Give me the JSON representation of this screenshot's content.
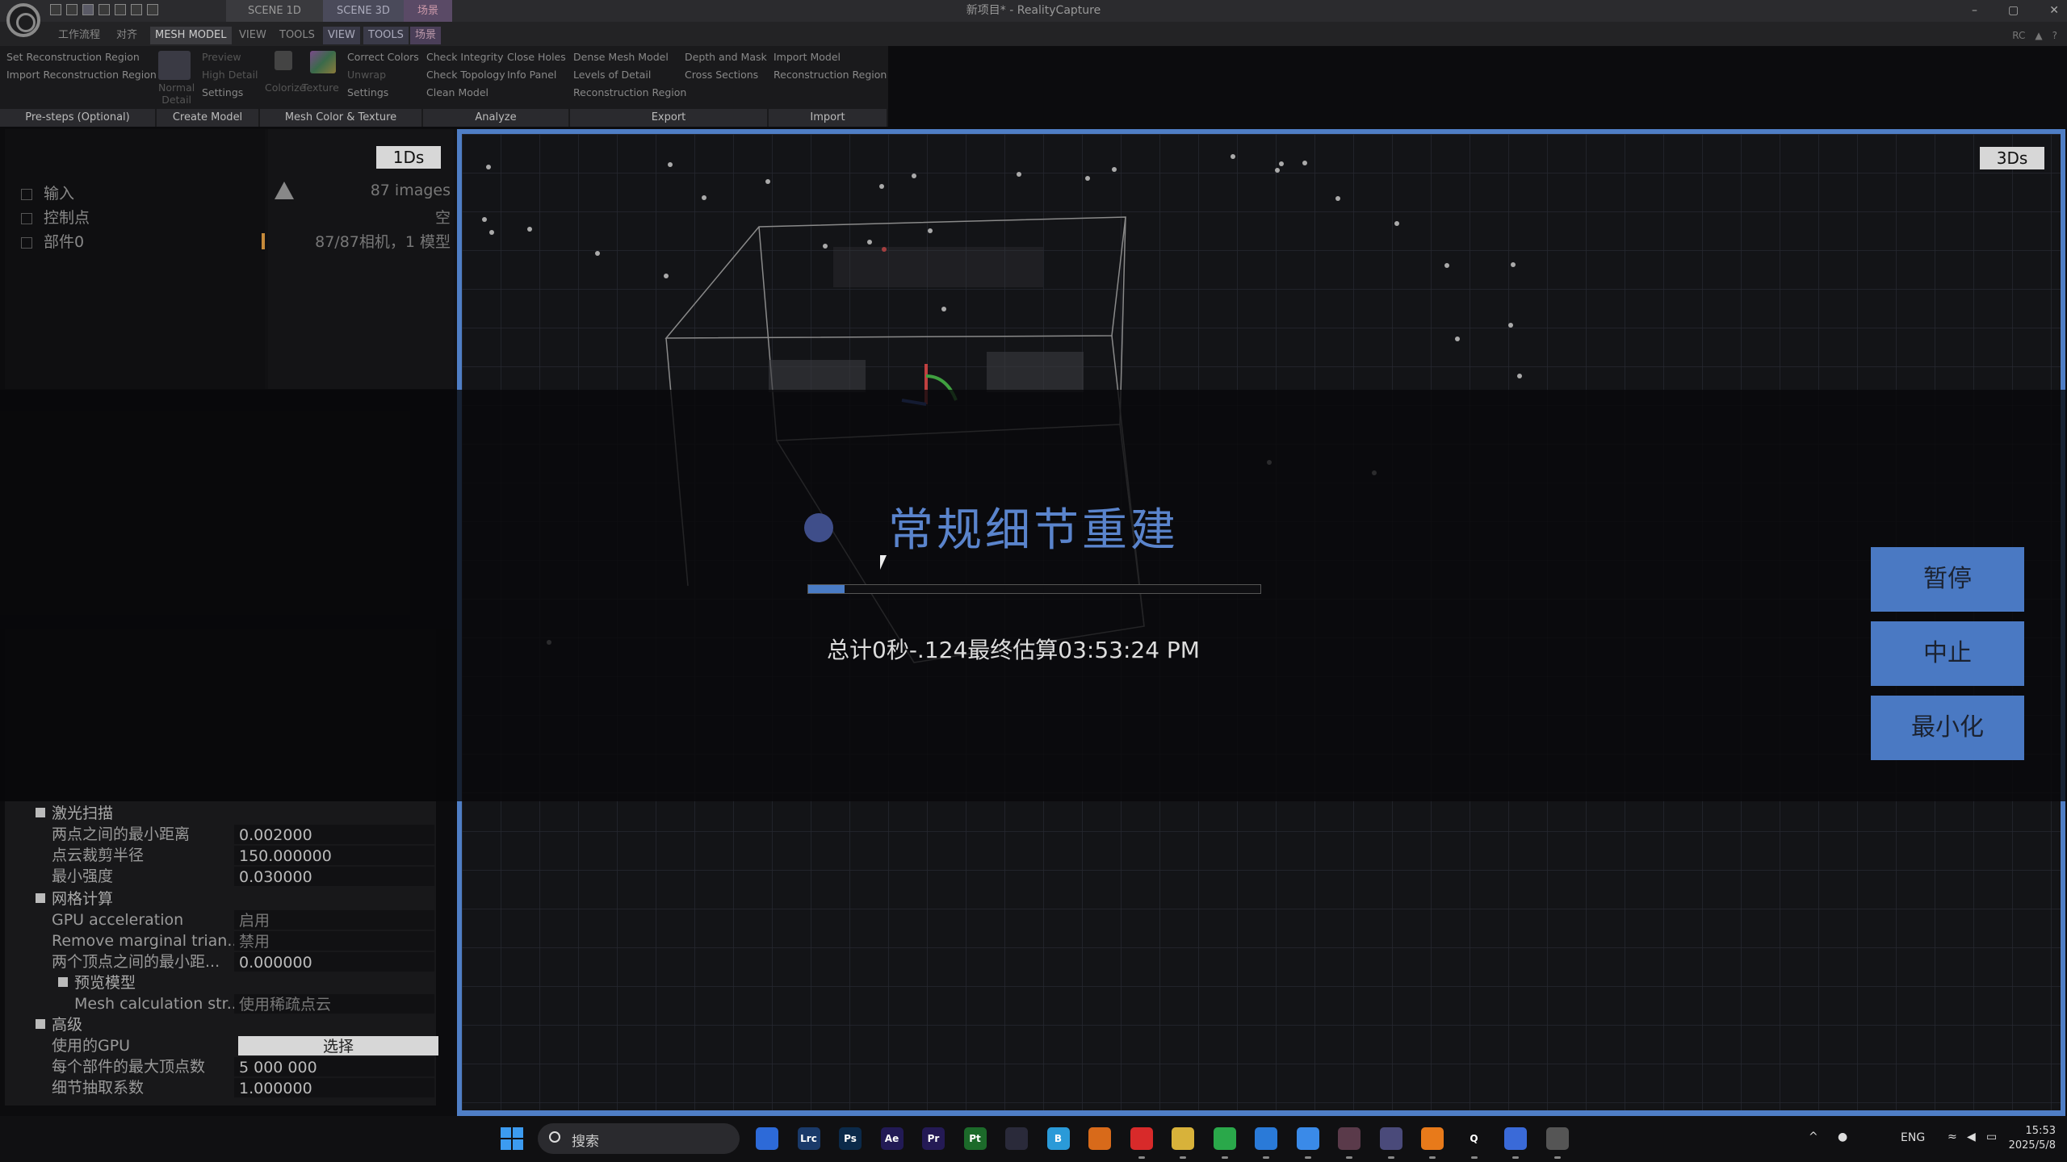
{
  "window": {
    "title": "新项目* - RealityCapture",
    "controls": [
      "–",
      "▢",
      "✕"
    ]
  },
  "scene_tabs": {
    "scene1d": "SCENE 1D",
    "scene3d": "SCENE 3D",
    "scene_cn": "场景"
  },
  "ribbon_tabs": {
    "workflow": "工作流程",
    "align": "对齐",
    "mesh_model": "MESH MODEL",
    "view1": "VIEW",
    "tools1": "TOOLS",
    "view2": "VIEW",
    "tools2": "TOOLS",
    "scene": "场景",
    "rc": "RC"
  },
  "ribbon": {
    "set_region": "Set Reconstruction Region",
    "import_region": "Import Reconstruction Region",
    "normal_detail": "Normal\nDetail",
    "preview": "Preview",
    "high_detail": "High Detail",
    "settings1": "Settings",
    "colorize": "Colorize",
    "texture": "Texture",
    "correct_colors": "Correct Colors",
    "unwrap": "Unwrap",
    "settings2": "Settings",
    "check_integrity": "Check Integrity",
    "check_topology": "Check Topology",
    "clean_model": "Clean Model",
    "close_holes": "Close Holes",
    "info_panel": "Info Panel",
    "dense_mesh": "Dense Mesh Model",
    "levels_detail": "Levels of Detail",
    "recon_region_export": "Reconstruction Region",
    "depth_mask": "Depth and Mask",
    "cross_sections": "Cross Sections",
    "import_model": "Import Model",
    "recon_region_import": "Reconstruction Region",
    "groups": {
      "presteps": "Pre-steps (Optional)",
      "create_model": "Create Model",
      "mesh_color": "Mesh Color & Texture",
      "analyze": "Analyze",
      "export": "Export",
      "import": "Import"
    }
  },
  "left_panel": {
    "badge": "1Ds",
    "tree": [
      "输入",
      "控制点",
      "部件0"
    ],
    "info": [
      "87 images",
      "空",
      "87/87相机，1 模型"
    ]
  },
  "settings": {
    "section_laser": "激光扫描",
    "min_point_distance_label": "两点之间的最小距离",
    "min_point_distance": "0.002000",
    "crop_radius_label": "点云裁剪半径",
    "crop_radius": "150.000000",
    "min_intensity_label": "最小强度",
    "min_intensity": "0.030000",
    "section_mesh": "网格计算",
    "gpu_accel_label": "GPU acceleration",
    "gpu_accel": "启用",
    "remove_marginal_label": "Remove marginal trian...",
    "remove_marginal": "禁用",
    "min_vertex_distance_label": "两个顶点之间的最小距...",
    "min_vertex_distance": "0.000000",
    "section_preview": "预览模型",
    "mesh_calc_label": "Mesh calculation str...",
    "mesh_calc": "使用稀疏点云",
    "section_advanced": "高级",
    "gpu_label": "使用的GPU",
    "gpu_select": "选择",
    "max_vertices_label": "每个部件的最大顶点数",
    "max_vertices": "5 000 000",
    "detail_decimation_label": "细节抽取系数",
    "detail_decimation": "1.000000"
  },
  "viewport": {
    "badge": "3Ds"
  },
  "progress": {
    "title": "常规细节重建",
    "fraction": 0.08,
    "time_text": "总计0秒-.124最终估算03:53:24 PM",
    "pause": "暂停",
    "abort": "中止",
    "minimize": "最小化"
  },
  "taskbar": {
    "search_placeholder": "搜索",
    "apps": [
      {
        "name": "store",
        "label": "",
        "color": "#2d6ad8"
      },
      {
        "name": "lightroom-classic",
        "label": "Lrc",
        "color": "#1a3a6a"
      },
      {
        "name": "photoshop",
        "label": "Ps",
        "color": "#0b2a4a"
      },
      {
        "name": "after-effects",
        "label": "Ae",
        "color": "#221a55"
      },
      {
        "name": "premiere",
        "label": "Pr",
        "color": "#241a55"
      },
      {
        "name": "pycharm",
        "label": "Pt",
        "color": "#1c6a2a"
      },
      {
        "name": "app-tool",
        "label": "",
        "color": "#2a2a3a"
      },
      {
        "name": "bilibili",
        "label": "B",
        "color": "#2a9ad8"
      },
      {
        "name": "firefox",
        "label": "",
        "color": "#d86a1a"
      },
      {
        "name": "netease-music",
        "label": "",
        "color": "#d82a2a"
      },
      {
        "name": "file-explorer",
        "label": "",
        "color": "#d8b23a"
      },
      {
        "name": "wechat",
        "label": "",
        "color": "#2aa84a"
      },
      {
        "name": "app-blue",
        "label": "",
        "color": "#2a7ad8"
      },
      {
        "name": "feishu",
        "label": "",
        "color": "#3a8ae8"
      },
      {
        "name": "davinci",
        "label": "",
        "color": "#5a3a4a"
      },
      {
        "name": "cat-app",
        "label": "",
        "color": "#4a4a7a"
      },
      {
        "name": "blender",
        "label": "",
        "color": "#e87a1a"
      },
      {
        "name": "search-q",
        "label": "Q",
        "color": "#101012"
      },
      {
        "name": "app-link",
        "label": "",
        "color": "#3a6ad8"
      },
      {
        "name": "realitycapture",
        "label": "",
        "color": "#555"
      }
    ],
    "lang": "ENG",
    "time": "15:53",
    "date": "2025/5/8"
  }
}
